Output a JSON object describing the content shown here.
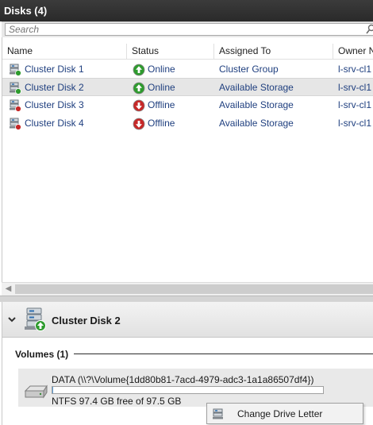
{
  "header": {
    "title": "Disks (4)"
  },
  "search": {
    "placeholder": "Search",
    "value": ""
  },
  "columns": [
    "Name",
    "Status",
    "Assigned To",
    "Owner Node"
  ],
  "rows": [
    {
      "name": "Cluster Disk 1",
      "status": "Online",
      "status_kind": "online",
      "assigned": "Cluster Group",
      "owner": "l-srv-cl1",
      "selected": false
    },
    {
      "name": "Cluster Disk 2",
      "status": "Online",
      "status_kind": "online",
      "assigned": "Available Storage",
      "owner": "l-srv-cl1",
      "selected": true
    },
    {
      "name": "Cluster Disk 3",
      "status": "Offline",
      "status_kind": "offline",
      "assigned": "Available Storage",
      "owner": "l-srv-cl1",
      "selected": false
    },
    {
      "name": "Cluster Disk 4",
      "status": "Offline",
      "status_kind": "offline",
      "assigned": "Available Storage",
      "owner": "l-srv-cl1",
      "selected": false
    }
  ],
  "details": {
    "title": "Cluster Disk 2",
    "volumes_label": "Volumes (1)",
    "volume": {
      "name": "DATA (\\\\?\\Volume{1dd80b81-7acd-4979-adc3-1a1a86507df4})",
      "free_text": "NTFS 97.4 GB free of 97.5 GB",
      "used_fraction": 0.001
    }
  },
  "context_menu": {
    "items": [
      {
        "label": "Change Drive Letter"
      }
    ]
  },
  "colors": {
    "online": "#2e9b2e",
    "offline": "#c62828",
    "link": "#1f3f7f",
    "header": "#2f2f2f"
  }
}
